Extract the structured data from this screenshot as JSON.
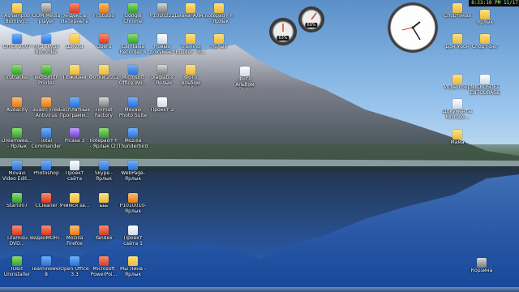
{
  "system_clock": "8:23:10 PM 11/17",
  "gadgets": {
    "cpu_percent": "63%",
    "memory_percent": "69%"
  },
  "desktop_icons": [
    {
      "label": "Ashampoo\nBurning...",
      "kind": "folder",
      "col": 0,
      "row": 0
    },
    {
      "label": "GOM Media\nplayer",
      "kind": "gray",
      "col": 1,
      "row": 0
    },
    {
      "label": "Яндекс в\nИнтернете",
      "kind": "red",
      "col": 2,
      "row": 0
    },
    {
      "label": "Fl Studio",
      "kind": "orange",
      "col": 3,
      "row": 0
    },
    {
      "label": "Google\nChrome",
      "kind": "green",
      "col": 4,
      "row": 0
    },
    {
      "label": "P1010222",
      "kind": "gray",
      "col": 5,
      "row": 0
    },
    {
      "label": "Диана_Алм...",
      "kind": "folder",
      "col": 6,
      "row": 0
    },
    {
      "label": "notepad++\n- Ярлык",
      "kind": "folder",
      "col": 7,
      "row": 0
    },
    {
      "label": "Office 2007",
      "kind": "app",
      "col": 0,
      "row": 1
    },
    {
      "label": "MP3 skype\nRecorder",
      "kind": "app",
      "col": 1,
      "row": 1
    },
    {
      "label": "Школа",
      "kind": "folder",
      "col": 2,
      "row": 1
    },
    {
      "label": "Opera",
      "kind": "red",
      "col": 3,
      "row": 1
    },
    {
      "label": "Camtasia\nRecorder 8",
      "kind": "green",
      "col": 4,
      "row": 1
    },
    {
      "label": "Новый\nдокумент",
      "kind": "doc",
      "col": 5,
      "row": 1
    },
    {
      "label": "Training\nBuilder - Я...",
      "kind": "folder",
      "col": 6,
      "row": 1
    },
    {
      "label": "Ярлык",
      "kind": "folder",
      "col": 7,
      "row": 1
    },
    {
      "label": "Trutracker",
      "kind": "green",
      "col": 0,
      "row": 2
    },
    {
      "label": "TechSmith\nPrinter",
      "kind": "green",
      "col": 1,
      "row": 2
    },
    {
      "label": "Пожизни",
      "kind": "folder",
      "col": 2,
      "row": 2
    },
    {
      "label": "Фотки 2012",
      "kind": "folder",
      "col": 3,
      "row": 2
    },
    {
      "label": "Microsoft\nOffice Wo...",
      "kind": "app",
      "col": 4,
      "row": 2
    },
    {
      "label": "plagiatus\n- Ярлык",
      "kind": "gray",
      "col": 5,
      "row": 2
    },
    {
      "label": "Фото Альбом\n- Ярлык",
      "kind": "folder",
      "col": 6,
      "row": 2
    },
    {
      "label": "Audacity",
      "kind": "orange",
      "col": 0,
      "row": 3
    },
    {
      "label": "avast! Free\nAntivirus",
      "kind": "orange",
      "col": 1,
      "row": 3
    },
    {
      "label": "Бесплатные\nПрограмм...",
      "kind": "app",
      "col": 2,
      "row": 3
    },
    {
      "label": "Format\nFactory",
      "kind": "gray",
      "col": 3,
      "row": 3
    },
    {
      "label": "Movavi\nPhoto Suite",
      "kind": "app",
      "col": 4,
      "row": 3
    },
    {
      "label": "Проект 2",
      "kind": "doc",
      "col": 5,
      "row": 3
    },
    {
      "label": "Dreamwea...\n- Ярлык",
      "kind": "green",
      "col": 0,
      "row": 4
    },
    {
      "label": "Total\nCommander",
      "kind": "app",
      "col": 1,
      "row": 4
    },
    {
      "label": "Picasa 3",
      "kind": "purple",
      "col": 2,
      "row": 4
    },
    {
      "label": "notepad++\n- Ярлык (2)",
      "kind": "green",
      "col": 3,
      "row": 4
    },
    {
      "label": "Mozilla\nThunderbird",
      "kind": "app",
      "col": 4,
      "row": 4
    },
    {
      "label": "Movavi\nVideo Edit...",
      "kind": "app",
      "col": 0,
      "row": 5
    },
    {
      "label": "Photoshop",
      "kind": "app",
      "col": 1,
      "row": 5
    },
    {
      "label": "Проект\nсайта",
      "kind": "doc",
      "col": 2,
      "row": 5
    },
    {
      "label": "Skype -\nЯрлык",
      "kind": "app",
      "col": 3,
      "row": 5
    },
    {
      "label": "WebPage-\nЯрлык",
      "kind": "app",
      "col": 4,
      "row": 5
    },
    {
      "label": "Start007",
      "kind": "green",
      "col": 0,
      "row": 6
    },
    {
      "label": "CCleaner",
      "kind": "red",
      "col": 1,
      "row": 6
    },
    {
      "label": "Учимся за...",
      "kind": "folder",
      "col": 2,
      "row": 6
    },
    {
      "label": "ььь",
      "kind": "folder",
      "col": 3,
      "row": 6
    },
    {
      "label": "P1010010-\nЯрлык",
      "kind": "orange",
      "col": 4,
      "row": 6
    },
    {
      "label": "Tiramisu\nDVD...",
      "kind": "red",
      "col": 0,
      "row": 7
    },
    {
      "label": "ВидеоМОНТ...",
      "kind": "red",
      "col": 1,
      "row": 7
    },
    {
      "label": "Mozilla\nFirefox",
      "kind": "orange",
      "col": 2,
      "row": 7
    },
    {
      "label": "Yandex",
      "kind": "red",
      "col": 3,
      "row": 7
    },
    {
      "label": "Проект\nсайта 1",
      "kind": "doc",
      "col": 4,
      "row": 7
    },
    {
      "label": "IOBit\nUninstaller",
      "kind": "green",
      "col": 0,
      "row": 8
    },
    {
      "label": "TeamViewer\n8",
      "kind": "app",
      "col": 1,
      "row": 8
    },
    {
      "label": "Open Office\n3.3",
      "kind": "app",
      "col": 2,
      "row": 8
    },
    {
      "label": "Microsoft\nPowerPoi...",
      "kind": "red",
      "col": 3,
      "row": 8
    },
    {
      "label": "Мы Лина -\nЯрлык",
      "kind": "folder",
      "col": 4,
      "row": 8
    }
  ],
  "right_icons": [
    {
      "label": "Спортиква",
      "kind": "folder",
      "row": 0
    },
    {
      "label": "Дон Урон",
      "kind": "folder",
      "row": 1
    },
    {
      "label": "Игры сбор",
      "kind": "folder",
      "row": 2
    },
    {
      "label": "Документы\nMicroso...",
      "kind": "doc",
      "row": 3
    },
    {
      "label": "Мама",
      "kind": "folder",
      "row": 4
    }
  ],
  "right_icons_col2": [
    {
      "label": "Ярлык",
      "kind": "folder",
      "row": 0
    },
    {
      "label": "Спорт-Бег",
      "kind": "folder",
      "row": 1
    },
    {
      "label": "MICROSOFT\nENTOURAGE",
      "kind": "doc",
      "row": 2
    }
  ],
  "recycle_bin": {
    "label": "Корзина",
    "kind": "gray"
  },
  "middle_icons": [
    {
      "label": "Фото Альбом\n- Ярлык",
      "kind": "doc"
    }
  ]
}
